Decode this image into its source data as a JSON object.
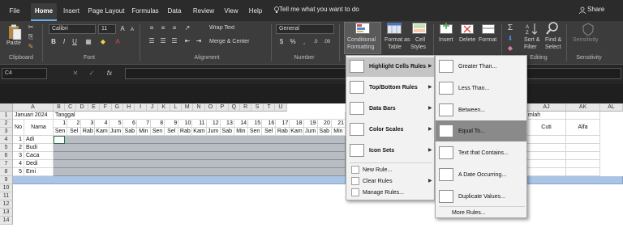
{
  "tabs": [
    "File",
    "Home",
    "Insert",
    "Page Layout",
    "Formulas",
    "Data",
    "Review",
    "View",
    "Help"
  ],
  "tell_me": "Tell me what you want to do",
  "share": "Share",
  "ribbon": {
    "paste": "Paste",
    "font_name": "Calibri",
    "font_size": "11",
    "wrap_text": "Wrap Text",
    "merge_center": "Merge & Center",
    "number_format": "General",
    "cond_formatting": "Conditional",
    "cond_formatting2": "Formatting",
    "format_as_table": "Format as",
    "format_as_table2": "Table",
    "cell_styles": "Cell",
    "cell_styles2": "Styles",
    "insert": "Insert",
    "delete": "Delete",
    "format": "Format",
    "sort_filter": "Sort &",
    "sort_filter2": "Filter",
    "find_select": "Find &",
    "find_select2": "Select",
    "sensitivity": "Sensitivity",
    "groups": {
      "clipboard": "Clipboard",
      "font": "Font",
      "alignment": "Alignment",
      "number": "Number",
      "editing": "Editing",
      "sensitivity": "Sensitivity"
    }
  },
  "name_box": "C4",
  "fx": "fx",
  "columns": [
    "A",
    "B",
    "C",
    "D",
    "E",
    "F",
    "G",
    "H",
    "I",
    "J",
    "K",
    "L",
    "M",
    "N",
    "O",
    "P",
    "Q",
    "R",
    "S",
    "T",
    "U"
  ],
  "right_columns": [
    "AJ",
    "AK",
    "AL"
  ],
  "rows": [
    "1",
    "2",
    "3",
    "4",
    "5",
    "6",
    "7",
    "8",
    "9",
    "10",
    "11",
    "12",
    "13",
    "14"
  ],
  "sheet": {
    "bulan": "Januari 2024",
    "tanggal": "Tanggal",
    "no": "No",
    "nama": "Nama",
    "jumlah": "mlah",
    "cuti": "Cuti",
    "alfa": "Alfa",
    "dates": [
      "1",
      "2",
      "3",
      "4",
      "5",
      "6",
      "7",
      "8",
      "9",
      "10",
      "11",
      "12",
      "13",
      "14",
      "15",
      "16",
      "17",
      "18",
      "19",
      "20",
      "21"
    ],
    "days": [
      "Sen",
      "Sel",
      "Rab",
      "Kam",
      "Jum",
      "Sab",
      "Min",
      "Sen",
      "Sel",
      "Rab",
      "Kam",
      "Jum",
      "Sab",
      "Min",
      "Sen",
      "Sel",
      "Rab",
      "Kam",
      "Jum",
      "Sab",
      "Min"
    ],
    "people": [
      {
        "no": "1",
        "nama": "Adi"
      },
      {
        "no": "2",
        "nama": "Budi"
      },
      {
        "no": "3",
        "nama": "Caca"
      },
      {
        "no": "4",
        "nama": "Dedi"
      },
      {
        "no": "5",
        "nama": "Emi"
      }
    ]
  },
  "menu1": {
    "highlight": "Highlight Cells Rules",
    "topbottom": "Top/Bottom Rules",
    "databars": "Data Bars",
    "colorscales": "Color Scales",
    "iconsets": "Icon Sets",
    "newrule": "New Rule...",
    "clearrules": "Clear Rules",
    "managerules": "Manage Rules..."
  },
  "menu2": {
    "greater": "Greater Than...",
    "less": "Less Than...",
    "between": "Between...",
    "equal": "Equal To...",
    "textcontains": "Text that Contains...",
    "dateoccurring": "A Date Occurring...",
    "duplicate": "Duplicate Values...",
    "morerules": "More Rules..."
  }
}
